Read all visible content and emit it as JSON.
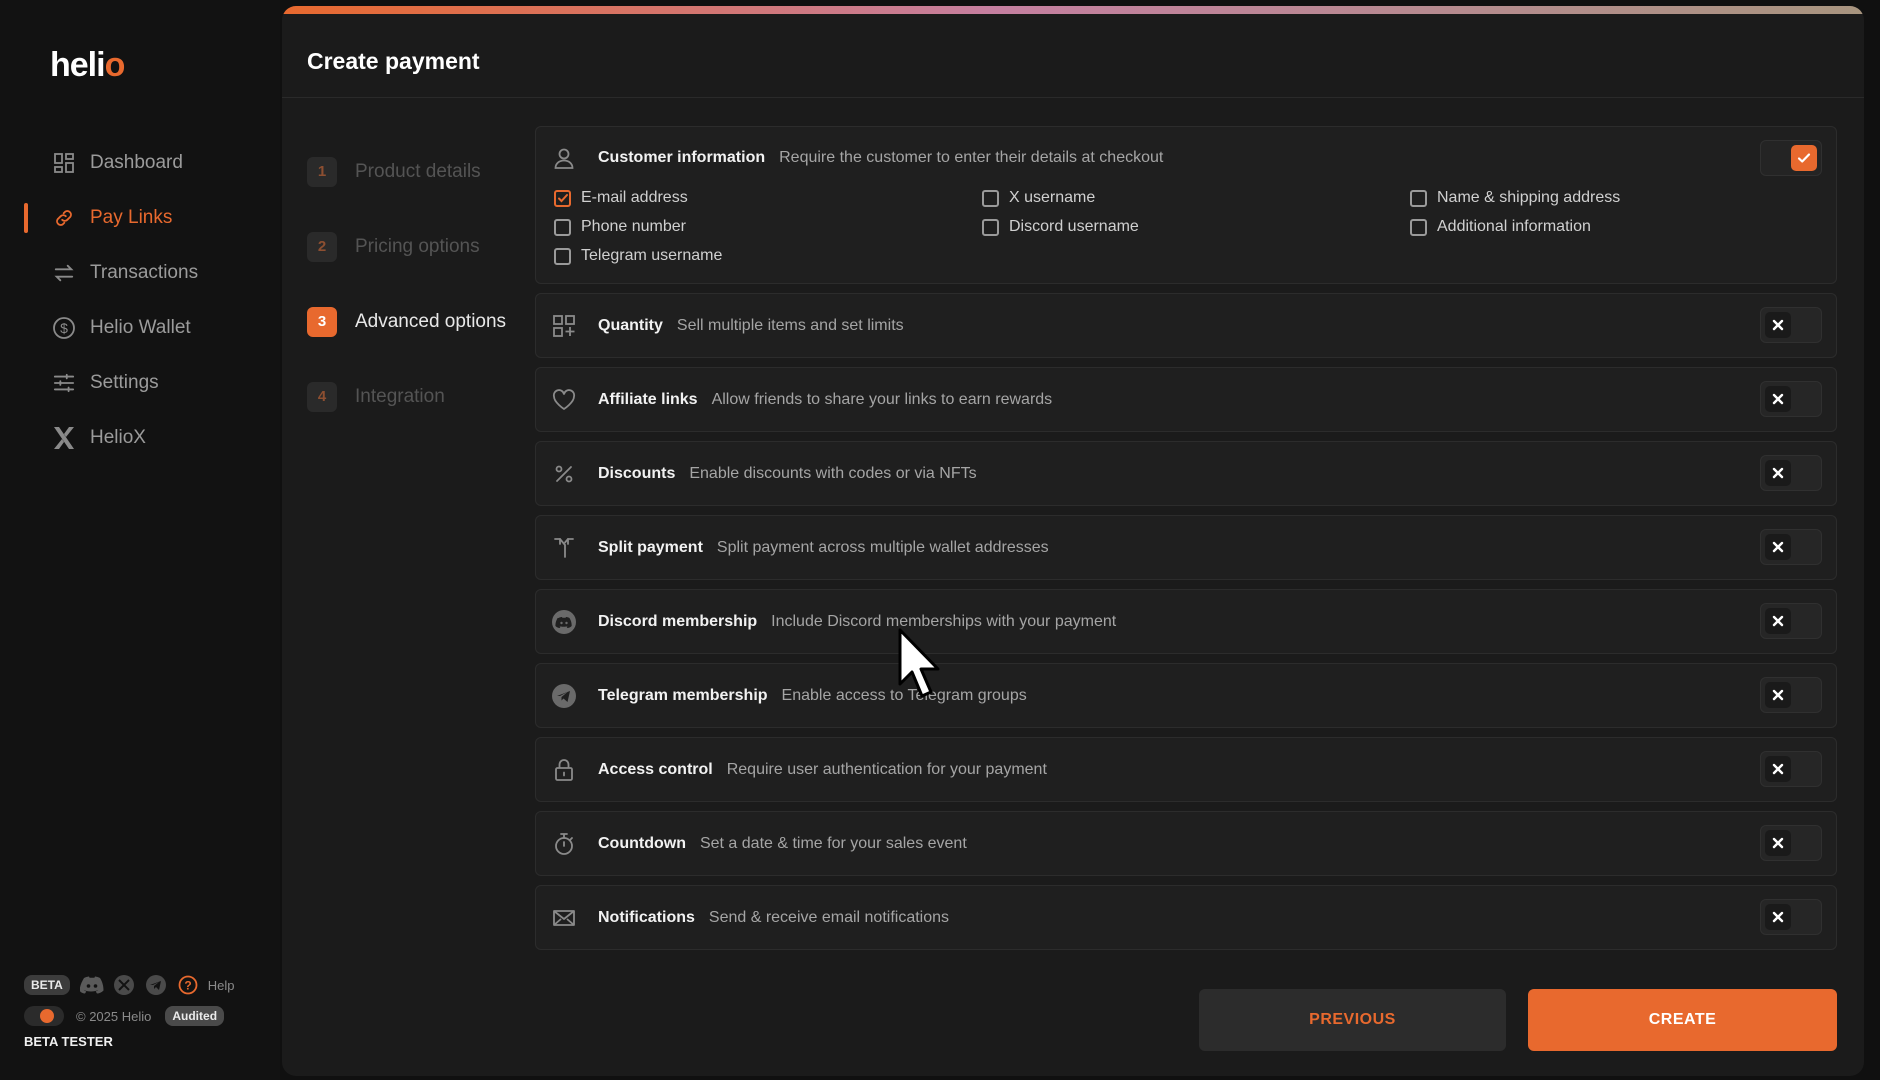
{
  "sidebar": {
    "logo": "heli",
    "logo_accent": "o",
    "nav": [
      {
        "label": "Dashboard",
        "icon": "dashboard-icon"
      },
      {
        "label": "Pay Links",
        "icon": "link-icon",
        "active": true
      },
      {
        "label": "Transactions",
        "icon": "arrows-exchange-icon"
      },
      {
        "label": "Helio Wallet",
        "icon": "dollar-circle-icon"
      },
      {
        "label": "Settings",
        "icon": "sliders-icon"
      },
      {
        "label": "HelioX",
        "icon": "x-logo-icon"
      }
    ],
    "footer": {
      "beta": "BETA",
      "help": "Help",
      "copyright": "© 2025 Helio",
      "audited": "Audited",
      "role": "BETA TESTER"
    }
  },
  "page": {
    "title": "Create payment"
  },
  "steps": [
    {
      "num": "1",
      "label": "Product details"
    },
    {
      "num": "2",
      "label": "Pricing options"
    },
    {
      "num": "3",
      "label": "Advanced options",
      "active": true
    },
    {
      "num": "4",
      "label": "Integration"
    }
  ],
  "customer_info": {
    "title": "Customer information",
    "desc": "Require the customer to enter their details at checkout",
    "enabled": true,
    "fields": [
      {
        "label": "E-mail address",
        "checked": true
      },
      {
        "label": "X username",
        "checked": false
      },
      {
        "label": "Name & shipping address",
        "checked": false
      },
      {
        "label": "Phone number",
        "checked": false
      },
      {
        "label": "Discord username",
        "checked": false
      },
      {
        "label": "Additional information",
        "checked": false
      },
      {
        "label": "Telegram username",
        "checked": false
      }
    ]
  },
  "options": [
    {
      "title": "Quantity",
      "desc": "Sell multiple items and set limits",
      "icon": "quantity-grid-icon",
      "enabled": false
    },
    {
      "title": "Affiliate links",
      "desc": "Allow friends to share your links to earn rewards",
      "icon": "heart-icon",
      "enabled": false
    },
    {
      "title": "Discounts",
      "desc": "Enable discounts with codes or via NFTs",
      "icon": "percent-icon",
      "enabled": false
    },
    {
      "title": "Split payment",
      "desc": "Split payment across multiple wallet addresses",
      "icon": "split-arrows-icon",
      "enabled": false
    },
    {
      "title": "Discord membership",
      "desc": "Include Discord memberships with your payment",
      "icon": "discord-icon",
      "enabled": false
    },
    {
      "title": "Telegram membership",
      "desc": "Enable access to Telegram groups",
      "icon": "telegram-icon",
      "enabled": false
    },
    {
      "title": "Access control",
      "desc": "Require user authentication for your payment",
      "icon": "lock-icon",
      "enabled": false
    },
    {
      "title": "Countdown",
      "desc": "Set a date & time for your sales event",
      "icon": "stopwatch-icon",
      "enabled": false
    },
    {
      "title": "Notifications",
      "desc": "Send & receive email notifications",
      "icon": "envelope-icon",
      "enabled": false
    }
  ],
  "buttons": {
    "previous": "PREVIOUS",
    "create": "CREATE"
  },
  "colors": {
    "accent": "#e8692e",
    "background": "#101010",
    "panel": "#1b1b1b"
  }
}
